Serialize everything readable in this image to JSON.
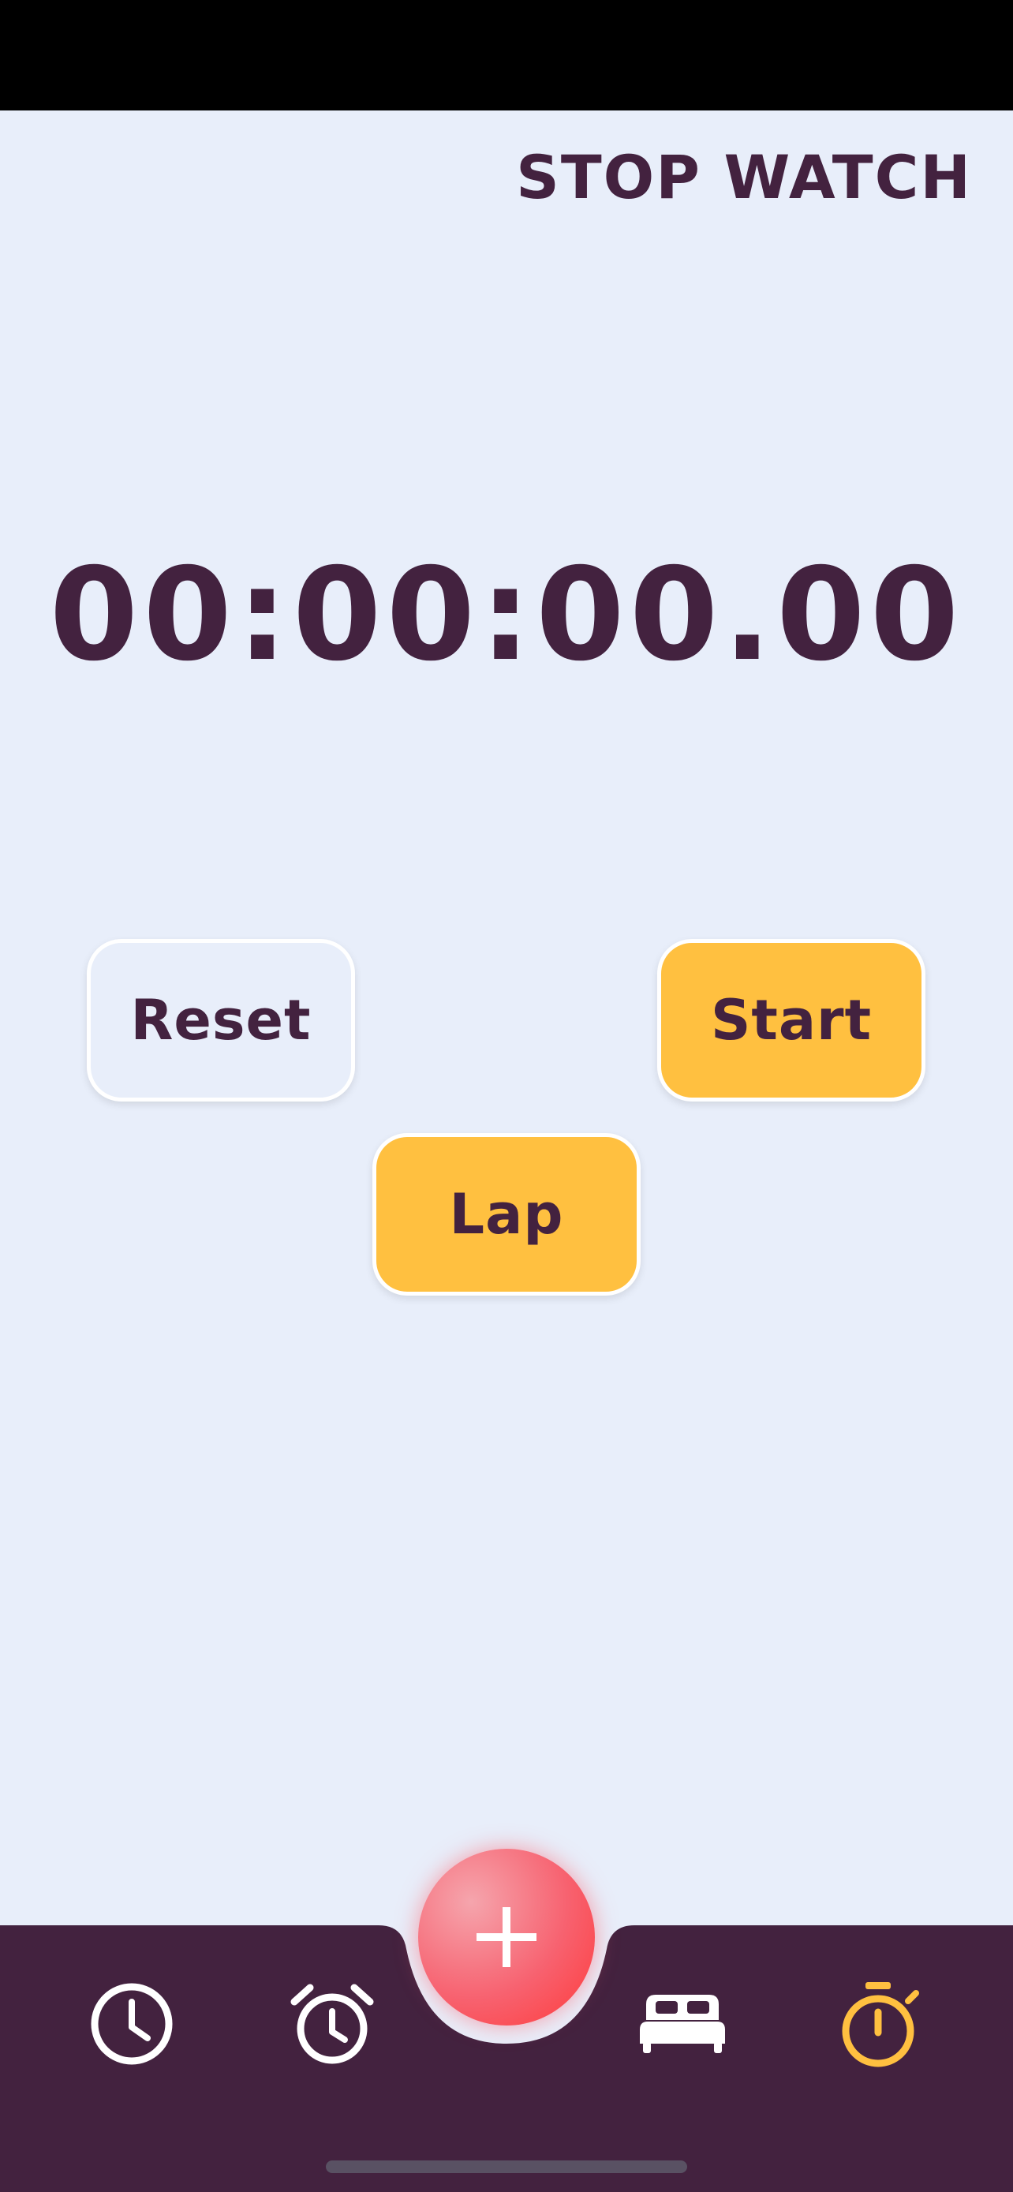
{
  "header": {
    "title": "STOP WATCH"
  },
  "timer": {
    "display": "00:00:00.00"
  },
  "controls": {
    "reset_label": "Reset",
    "start_label": "Start",
    "lap_label": "Lap"
  },
  "tab_bar": {
    "items": [
      {
        "name": "clock",
        "icon": "clock-icon",
        "active": false
      },
      {
        "name": "alarm",
        "icon": "alarm-clock-icon",
        "active": false
      },
      {
        "name": "bedtime",
        "icon": "bed-icon",
        "active": false
      },
      {
        "name": "stopwatch",
        "icon": "stopwatch-icon",
        "active": true
      }
    ],
    "fab_icon": "plus-icon"
  },
  "colors": {
    "background": "#e8eefa",
    "primary_text": "#43223f",
    "accent": "#ffc040",
    "tab_bar": "#43223f",
    "fab": "#f76270",
    "inactive_icon": "#ffffff",
    "active_icon": "#ffc040"
  }
}
